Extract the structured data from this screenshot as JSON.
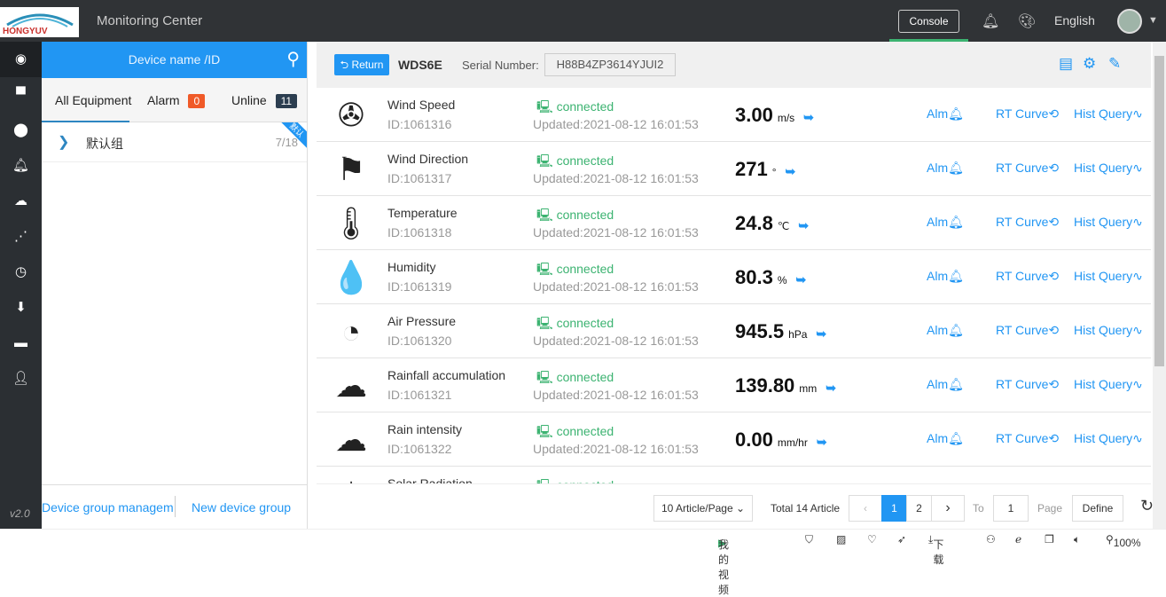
{
  "header": {
    "title": "Monitoring Center",
    "console": "Console",
    "language": "English",
    "logo_text": "HONGYUV"
  },
  "sidebar": {
    "version": "v2.0",
    "icons": [
      "target-icon",
      "monitor-icon",
      "location-icon",
      "bell-icon",
      "cloud-icon",
      "share-icon",
      "clock-icon",
      "download-icon",
      "card-icon",
      "user-icon"
    ]
  },
  "panel": {
    "search_placeholder": "Device name /ID",
    "tabs": {
      "all": "All Equipment",
      "alarm": "Alarm",
      "alarm_count": "0",
      "online": "Unline",
      "online_count": "11"
    },
    "group": {
      "name": "默认组",
      "count": "7/18",
      "ribbon": "默认"
    },
    "footer": {
      "manage": "Device group managem",
      "new": "New device group"
    }
  },
  "main": {
    "return": "Return",
    "device": "WDS6E",
    "serial_label": "Serial Number:",
    "serial": "H88B4ZP3614YJUI2",
    "rows": [
      {
        "icon": "wind-turbine-icon",
        "glyph": "✇",
        "name": "Wind Speed",
        "id": "ID:1061316",
        "status": "connected",
        "updated": "Updated:2021-08-12 16:01:53",
        "value": "3.00",
        "unit": "m/s"
      },
      {
        "icon": "windsock-icon",
        "glyph": "⚑",
        "name": "Wind Direction",
        "id": "ID:1061317",
        "status": "connected",
        "updated": "Updated:2021-08-12 16:01:53",
        "value": "271",
        "unit": "°"
      },
      {
        "icon": "thermometer-icon",
        "glyph": "🌡",
        "name": "Temperature",
        "id": "ID:1061318",
        "status": "connected",
        "updated": "Updated:2021-08-12 16:01:53",
        "value": "24.8",
        "unit": "℃"
      },
      {
        "icon": "humidity-icon",
        "glyph": "💧",
        "name": "Humidity",
        "id": "ID:1061319",
        "status": "connected",
        "updated": "Updated:2021-08-12 16:01:53",
        "value": "80.3",
        "unit": "%"
      },
      {
        "icon": "gauge-icon",
        "glyph": "◔",
        "name": "Air Pressure",
        "id": "ID:1061320",
        "status": "connected",
        "updated": "Updated:2021-08-12 16:01:53",
        "value": "945.5",
        "unit": "hPa"
      },
      {
        "icon": "rain-cloud-icon",
        "glyph": "☁",
        "name": "Rainfall accumulation",
        "id": "ID:1061321",
        "status": "connected",
        "updated": "Updated:2021-08-12 16:01:53",
        "value": "139.80",
        "unit": "mm"
      },
      {
        "icon": "rain-cloud-icon",
        "glyph": "☁",
        "name": "Rain intensity",
        "id": "ID:1061322",
        "status": "connected",
        "updated": "Updated:2021-08-12 16:01:53",
        "value": "0.00",
        "unit": "mm/hr"
      },
      {
        "icon": "sun-icon",
        "glyph": "☀",
        "name": "Solar Radiation",
        "id": "",
        "status": "connected",
        "updated": "",
        "value": "",
        "unit": ""
      }
    ],
    "links": {
      "alarm": "Alm",
      "rt": "RT Curve",
      "hist": "Hist Query"
    },
    "pager": {
      "per_page": "10 Article/Page",
      "total": "Total 14 Article",
      "pages": [
        "1",
        "2"
      ],
      "current": "1",
      "to": "To",
      "goto": "1",
      "page": "Page",
      "define": "Define"
    }
  },
  "statusbar": {
    "video": "我的视频",
    "download": "下载",
    "zoom": "100%"
  },
  "colors": {
    "accent": "#2196f3",
    "connected": "#3cb371",
    "alarm": "#f05a28"
  }
}
